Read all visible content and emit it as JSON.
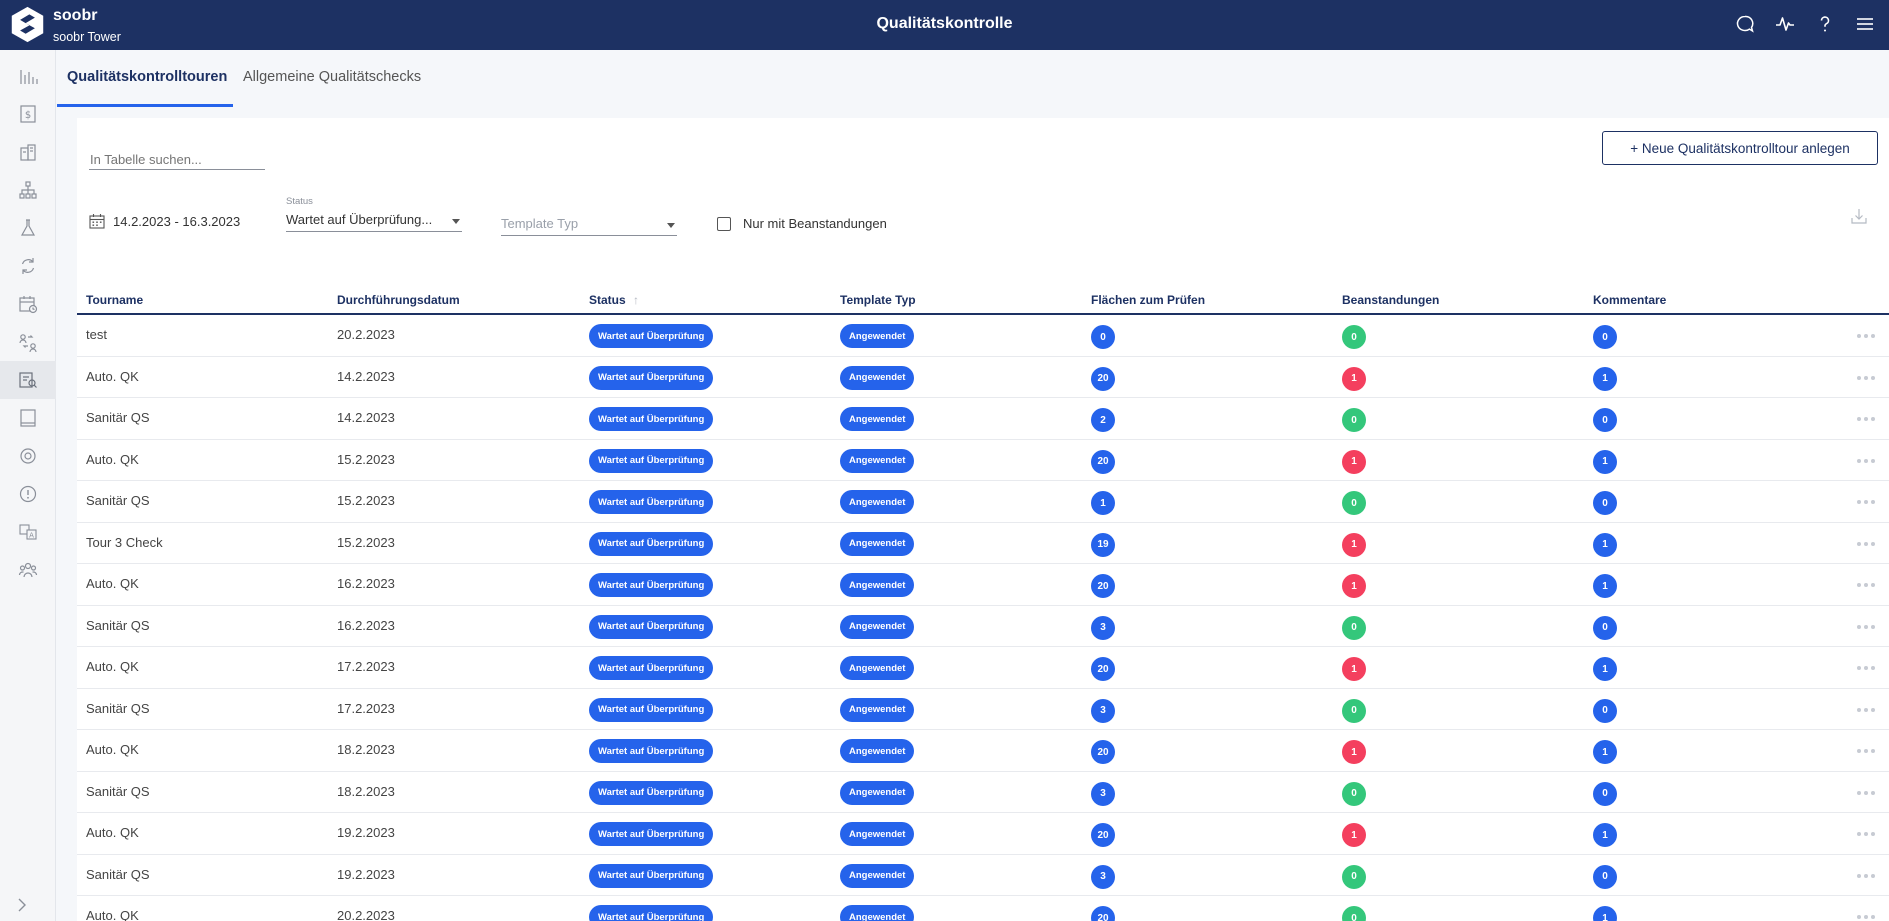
{
  "header": {
    "brand": "soobr",
    "sub_brand": "soobr Tower",
    "title": "Qualitätskontrolle",
    "icons": [
      "chat-icon",
      "activity-icon",
      "help-icon",
      "menu-icon"
    ]
  },
  "sidebar": {
    "items": [
      {
        "icon": "bar-chart-icon",
        "active": false
      },
      {
        "icon": "dollar-icon",
        "active": false
      },
      {
        "icon": "building-icon",
        "active": false
      },
      {
        "icon": "org-chart-icon",
        "active": false
      },
      {
        "icon": "flask-icon",
        "active": false
      },
      {
        "icon": "refresh-cycle-icon",
        "active": false
      },
      {
        "icon": "calendar-clock-icon",
        "active": false
      },
      {
        "icon": "swap-people-icon",
        "active": false
      },
      {
        "icon": "document-search-icon",
        "active": true
      },
      {
        "icon": "tablet-icon",
        "active": false
      },
      {
        "icon": "sensor-icon",
        "active": false
      },
      {
        "icon": "alert-circle-icon",
        "active": false
      },
      {
        "icon": "translate-icon",
        "active": false
      },
      {
        "icon": "people-group-icon",
        "active": false
      }
    ]
  },
  "tabs": [
    {
      "label": "Qualitätskontrolltouren",
      "active": true
    },
    {
      "label": "Allgemeine Qualitätschecks",
      "active": false
    }
  ],
  "toolbar": {
    "search_placeholder": "In Tabelle suchen...",
    "new_button": "+ Neue Qualitätskontrolltour anlegen",
    "date_range": "14.2.2023 - 16.3.2023",
    "status_label": "Status",
    "status_value": "Wartet auf Überprüfung...",
    "template_placeholder": "Template Typ",
    "checkbox_label": "Nur mit Beanstandungen"
  },
  "table": {
    "columns": [
      "Tourname",
      "Durchführungsdatum",
      "Status",
      "Template Typ",
      "Flächen zum Prüfen",
      "Beanstandungen",
      "Kommentare"
    ],
    "sort_indicator": "↑",
    "rows": [
      {
        "name": "test",
        "date": "20.2.2023",
        "status": "Wartet auf Überprüfung",
        "template": "Angewendet",
        "flaechen": "0",
        "beanstandungen": "0",
        "kommentare": "0"
      },
      {
        "name": "Auto. QK",
        "date": "14.2.2023",
        "status": "Wartet auf Überprüfung",
        "template": "Angewendet",
        "flaechen": "20",
        "beanstandungen": "1",
        "kommentare": "1"
      },
      {
        "name": "Sanitär QS",
        "date": "14.2.2023",
        "status": "Wartet auf Überprüfung",
        "template": "Angewendet",
        "flaechen": "2",
        "beanstandungen": "0",
        "kommentare": "0"
      },
      {
        "name": "Auto. QK",
        "date": "15.2.2023",
        "status": "Wartet auf Überprüfung",
        "template": "Angewendet",
        "flaechen": "20",
        "beanstandungen": "1",
        "kommentare": "1"
      },
      {
        "name": "Sanitär QS",
        "date": "15.2.2023",
        "status": "Wartet auf Überprüfung",
        "template": "Angewendet",
        "flaechen": "1",
        "beanstandungen": "0",
        "kommentare": "0"
      },
      {
        "name": "Tour 3 Check",
        "date": "15.2.2023",
        "status": "Wartet auf Überprüfung",
        "template": "Angewendet",
        "flaechen": "19",
        "beanstandungen": "1",
        "kommentare": "1"
      },
      {
        "name": "Auto. QK",
        "date": "16.2.2023",
        "status": "Wartet auf Überprüfung",
        "template": "Angewendet",
        "flaechen": "20",
        "beanstandungen": "1",
        "kommentare": "1"
      },
      {
        "name": "Sanitär QS",
        "date": "16.2.2023",
        "status": "Wartet auf Überprüfung",
        "template": "Angewendet",
        "flaechen": "3",
        "beanstandungen": "0",
        "kommentare": "0"
      },
      {
        "name": "Auto. QK",
        "date": "17.2.2023",
        "status": "Wartet auf Überprüfung",
        "template": "Angewendet",
        "flaechen": "20",
        "beanstandungen": "1",
        "kommentare": "1"
      },
      {
        "name": "Sanitär QS",
        "date": "17.2.2023",
        "status": "Wartet auf Überprüfung",
        "template": "Angewendet",
        "flaechen": "3",
        "beanstandungen": "0",
        "kommentare": "0"
      },
      {
        "name": "Auto. QK",
        "date": "18.2.2023",
        "status": "Wartet auf Überprüfung",
        "template": "Angewendet",
        "flaechen": "20",
        "beanstandungen": "1",
        "kommentare": "1"
      },
      {
        "name": "Sanitär QS",
        "date": "18.2.2023",
        "status": "Wartet auf Überprüfung",
        "template": "Angewendet",
        "flaechen": "3",
        "beanstandungen": "0",
        "kommentare": "0"
      },
      {
        "name": "Auto. QK",
        "date": "19.2.2023",
        "status": "Wartet auf Überprüfung",
        "template": "Angewendet",
        "flaechen": "20",
        "beanstandungen": "1",
        "kommentare": "1"
      },
      {
        "name": "Sanitär QS",
        "date": "19.2.2023",
        "status": "Wartet auf Überprüfung",
        "template": "Angewendet",
        "flaechen": "3",
        "beanstandungen": "0",
        "kommentare": "0"
      },
      {
        "name": "Auto. QK",
        "date": "20.2.2023",
        "status": "Wartet auf Überprüfung",
        "template": "Angewendet",
        "flaechen": "20",
        "beanstandungen": "0",
        "kommentare": "1"
      }
    ]
  },
  "colors": {
    "header_bg": "#1d3163",
    "accent_blue": "#2563eb",
    "danger_red": "#f43f5e",
    "success_green": "#34c77b"
  }
}
